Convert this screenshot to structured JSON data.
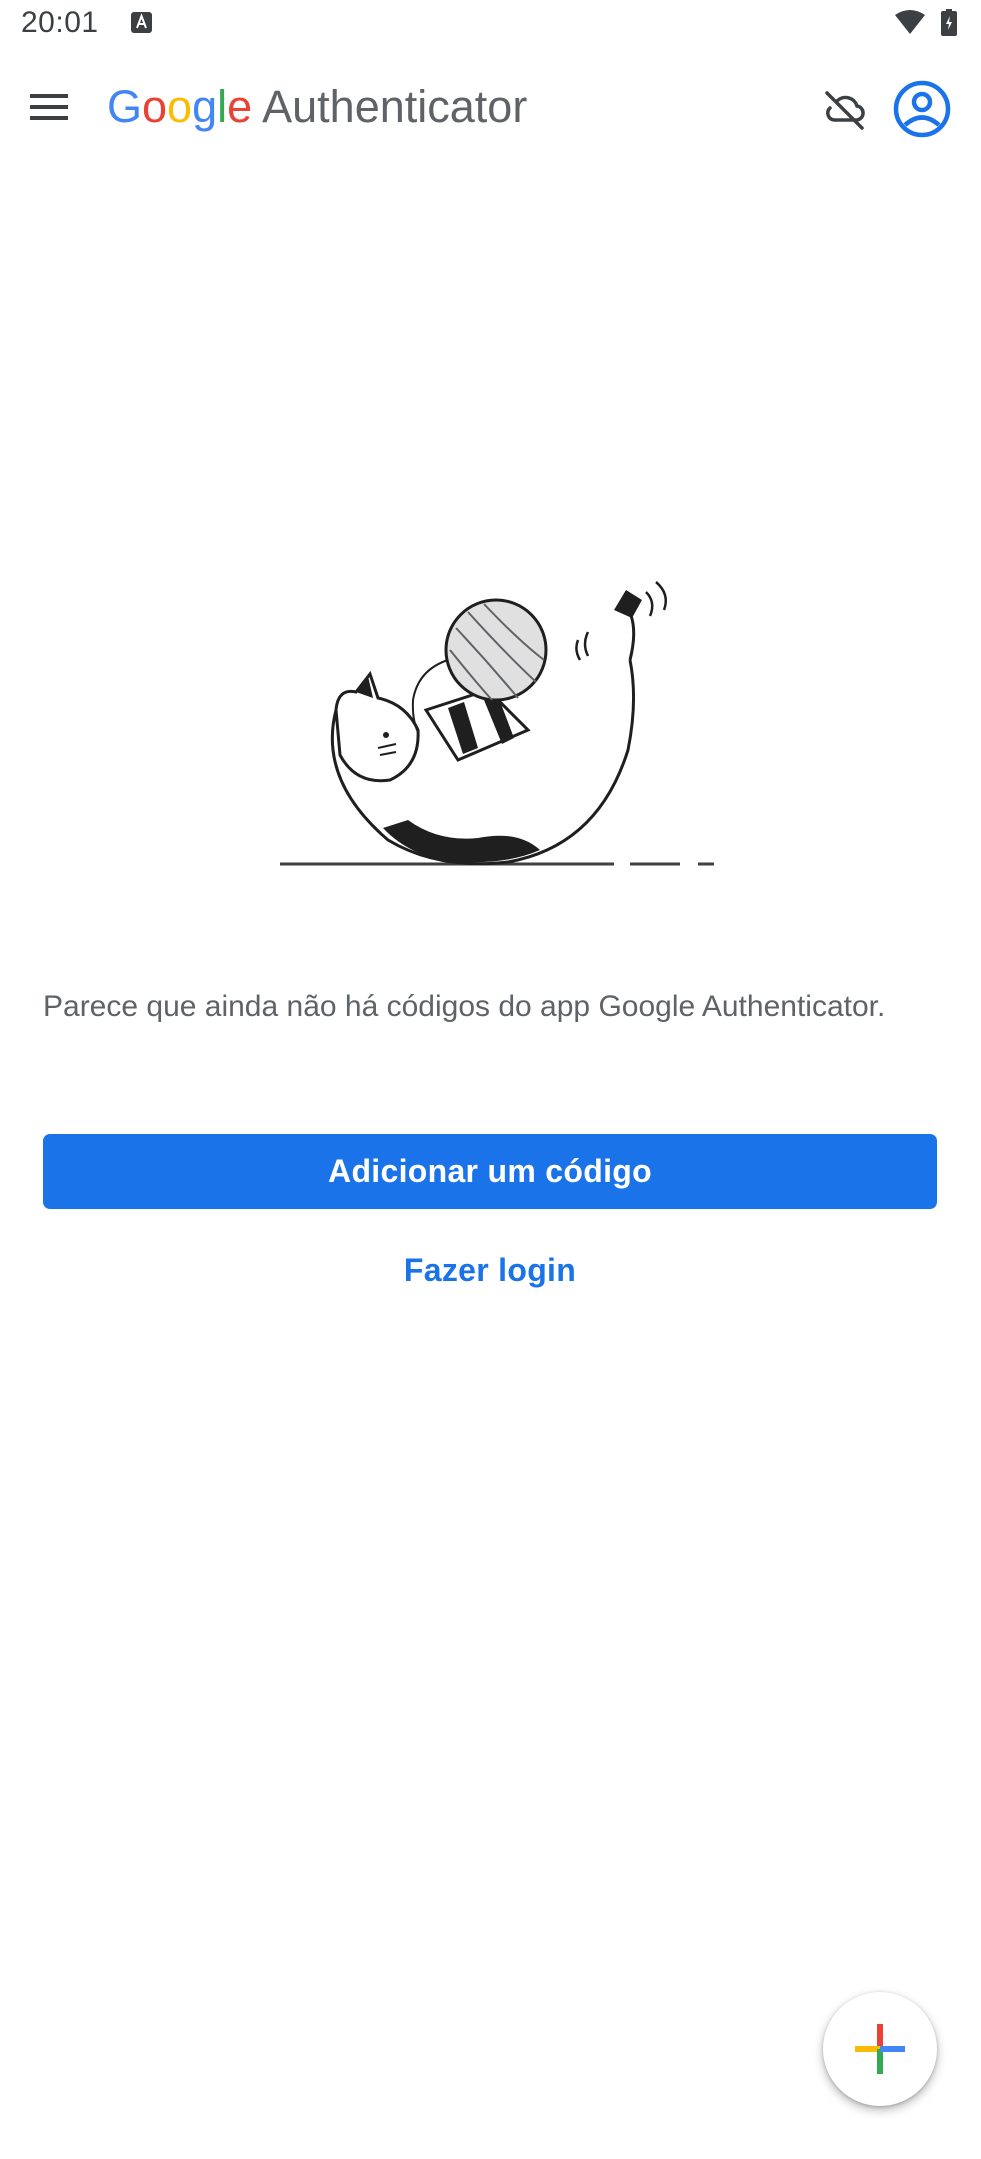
{
  "status_bar": {
    "time": "20:01",
    "icons": [
      "notification-a-icon",
      "wifi-icon",
      "battery-icon"
    ]
  },
  "app_bar": {
    "brand_letters": [
      "G",
      "o",
      "o",
      "g",
      "l",
      "e"
    ],
    "product": "Authenticator",
    "icons": [
      "menu-icon",
      "cloud-off-icon",
      "account-circle-icon"
    ]
  },
  "empty_state": {
    "illustration": "cat-playing-with-yarn",
    "message": "Parece que ainda não há códigos do app Google Authenticator."
  },
  "actions": {
    "add_code": "Adicionar um código",
    "login": "Fazer login"
  },
  "fab": {
    "icon": "plus-icon"
  },
  "colors": {
    "primary": "#1a73e8",
    "google_blue": "#4285F4",
    "google_red": "#EA4335",
    "google_yellow": "#FBBC05",
    "google_green": "#34A853",
    "text_secondary": "#5f6368"
  }
}
